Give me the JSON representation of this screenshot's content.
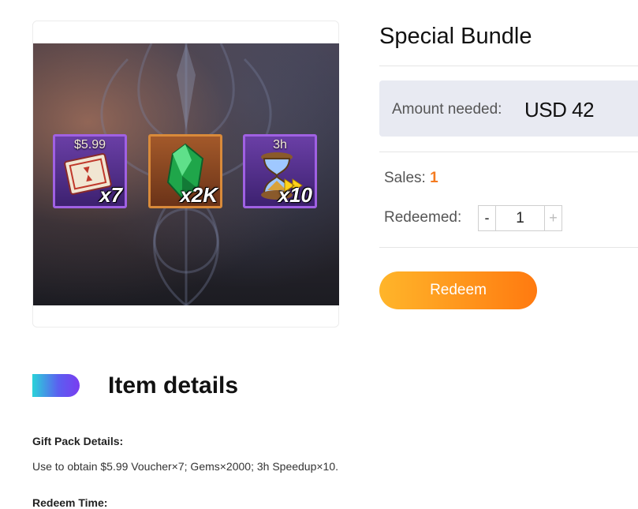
{
  "product": {
    "title": "Special Bundle",
    "amount_label": "Amount needed:",
    "amount_value": "USD 42",
    "sales_label": "Sales:",
    "sales_value": "1",
    "redeemed_label": "Redeemed:",
    "quantity": "1",
    "minus": "-",
    "plus": "+",
    "redeem_button": "Redeem"
  },
  "bundle_image": {
    "items": [
      {
        "icon": "voucher-icon",
        "top_label": "$5.99",
        "count": "x7",
        "frame": "purple"
      },
      {
        "icon": "gem-icon",
        "top_label": "",
        "count": "x2K",
        "frame": "orange"
      },
      {
        "icon": "hourglass-speedup-icon",
        "top_label": "3h",
        "count": "x10",
        "frame": "purple"
      }
    ]
  },
  "details": {
    "heading": "Item details",
    "gift_label": "Gift Pack Details:",
    "gift_desc": "Use to obtain $5.99 Voucher×7; Gems×2000; 3h Speedup×10.",
    "time_label": "Redeem Time:"
  },
  "colors": {
    "accent_orange": "#f47b20",
    "button_gradient_start": "#ffb52a",
    "button_gradient_end": "#ff7a10",
    "amount_bg": "#e8eaf2"
  }
}
